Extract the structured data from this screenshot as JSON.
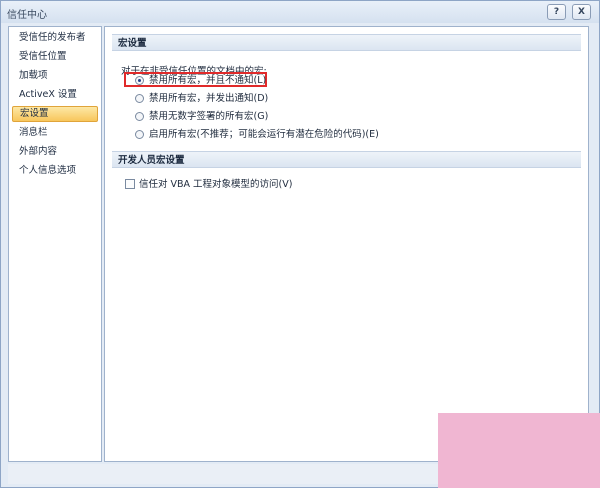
{
  "window": {
    "title": "信任中心",
    "help_button": "?",
    "close_button": "X"
  },
  "sidebar": {
    "items": [
      {
        "label": "受信任的发布者"
      },
      {
        "label": "受信任位置"
      },
      {
        "label": "加载项"
      },
      {
        "label": "ActiveX 设置"
      },
      {
        "label": "宏设置",
        "selected": true
      },
      {
        "label": "消息栏"
      },
      {
        "label": "外部内容"
      },
      {
        "label": "个人信息选项"
      }
    ]
  },
  "macro_settings": {
    "header": "宏设置",
    "prompt": "对于在非受信任位置的文档中的宏:",
    "options": [
      {
        "label": "禁用所有宏，并且不通知(L)",
        "selected": true
      },
      {
        "label": "禁用所有宏，并发出通知(D)",
        "selected": false
      },
      {
        "label": "禁用无数字签署的所有宏(G)",
        "selected": false
      },
      {
        "label": "启用所有宏(不推荐；可能会运行有潜在危险的代码)(E)",
        "selected": false
      }
    ]
  },
  "developer_settings": {
    "header": "开发人员宏设置",
    "trust_vba_label": "信任对 VBA 工程对象模型的访问(V)",
    "trust_vba_checked": false
  },
  "colors": {
    "highlight_border": "#e02a2a",
    "selected_nav": "#f8c65c",
    "overlay": "#f0b6d2"
  }
}
